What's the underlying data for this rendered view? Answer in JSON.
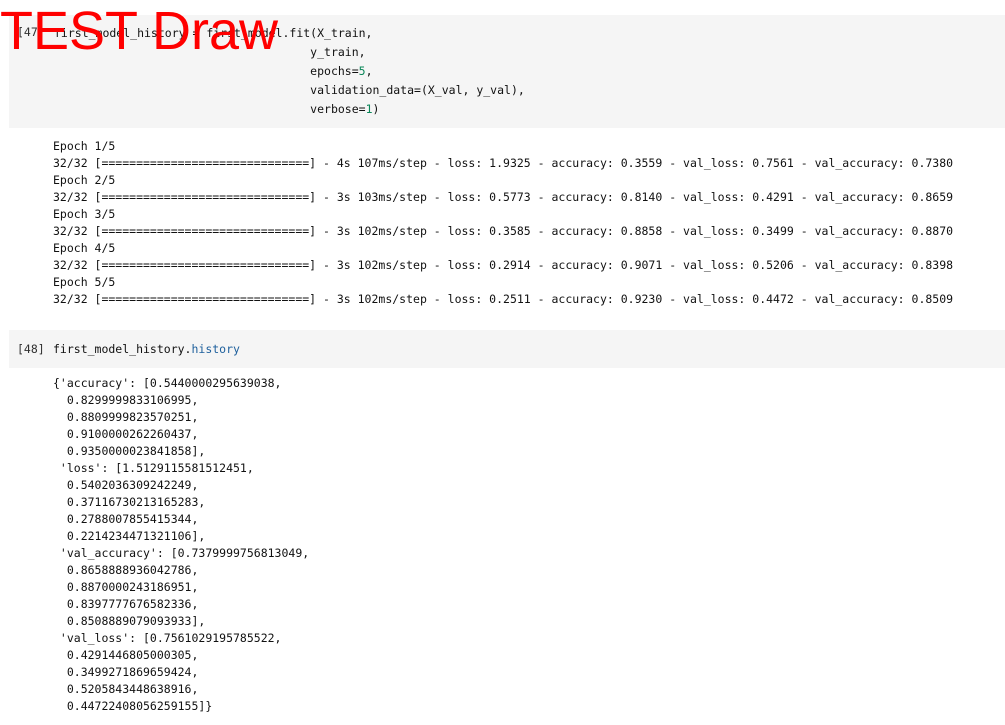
{
  "watermark": {
    "text": "TEST Draw",
    "color": "#ff0000"
  },
  "cell47": {
    "prompt": "[47]",
    "code": [
      "first_model_history = first_model.fit(X_train,",
      "                                     y_train,",
      "                                     epochs=5,",
      "                                     validation_data=(X_val, y_val),",
      "                                     verbose=1)"
    ],
    "output": [
      "Epoch 1/5",
      "32/32 [==============================] - 4s 107ms/step - loss: 1.9325 - accuracy: 0.3559 - val_loss: 0.7561 - val_accuracy: 0.7380",
      "Epoch 2/5",
      "32/32 [==============================] - 3s 103ms/step - loss: 0.5773 - accuracy: 0.8140 - val_loss: 0.4291 - val_accuracy: 0.8659",
      "Epoch 3/5",
      "32/32 [==============================] - 3s 102ms/step - loss: 0.3585 - accuracy: 0.8858 - val_loss: 0.3499 - val_accuracy: 0.8870",
      "Epoch 4/5",
      "32/32 [==============================] - 3s 102ms/step - loss: 0.2914 - accuracy: 0.9071 - val_loss: 0.5206 - val_accuracy: 0.8398",
      "Epoch 5/5",
      "32/32 [==============================] - 3s 102ms/step - loss: 0.2511 - accuracy: 0.9230 - val_loss: 0.4472 - val_accuracy: 0.8509"
    ]
  },
  "cell48": {
    "prompt": "[48]",
    "code_object": "first_model_history.",
    "code_attr": "history",
    "output": [
      "{'accuracy': [0.5440000295639038,",
      "  0.8299999833106995,",
      "  0.8809999823570251,",
      "  0.9100000262260437,",
      "  0.9350000023841858],",
      " 'loss': [1.5129115581512451,",
      "  0.5402036309242249,",
      "  0.37116730213165283,",
      "  0.2788007855415344,",
      "  0.2214234471321106],",
      " 'val_accuracy': [0.7379999756813049,",
      "  0.8658888936042786,",
      "  0.8870000243186951,",
      "  0.8397777676582336,",
      "  0.8508889079093933],",
      " 'val_loss': [0.7561029195785522,",
      "  0.4291446805000305,",
      "  0.3499271869659424,",
      "  0.5205843448638916,",
      "  0.44722408056259155]}"
    ]
  },
  "colors": {
    "input_background": "#f5f5f5",
    "number_literal": "#098658",
    "attribute": "#1d5f9c"
  }
}
